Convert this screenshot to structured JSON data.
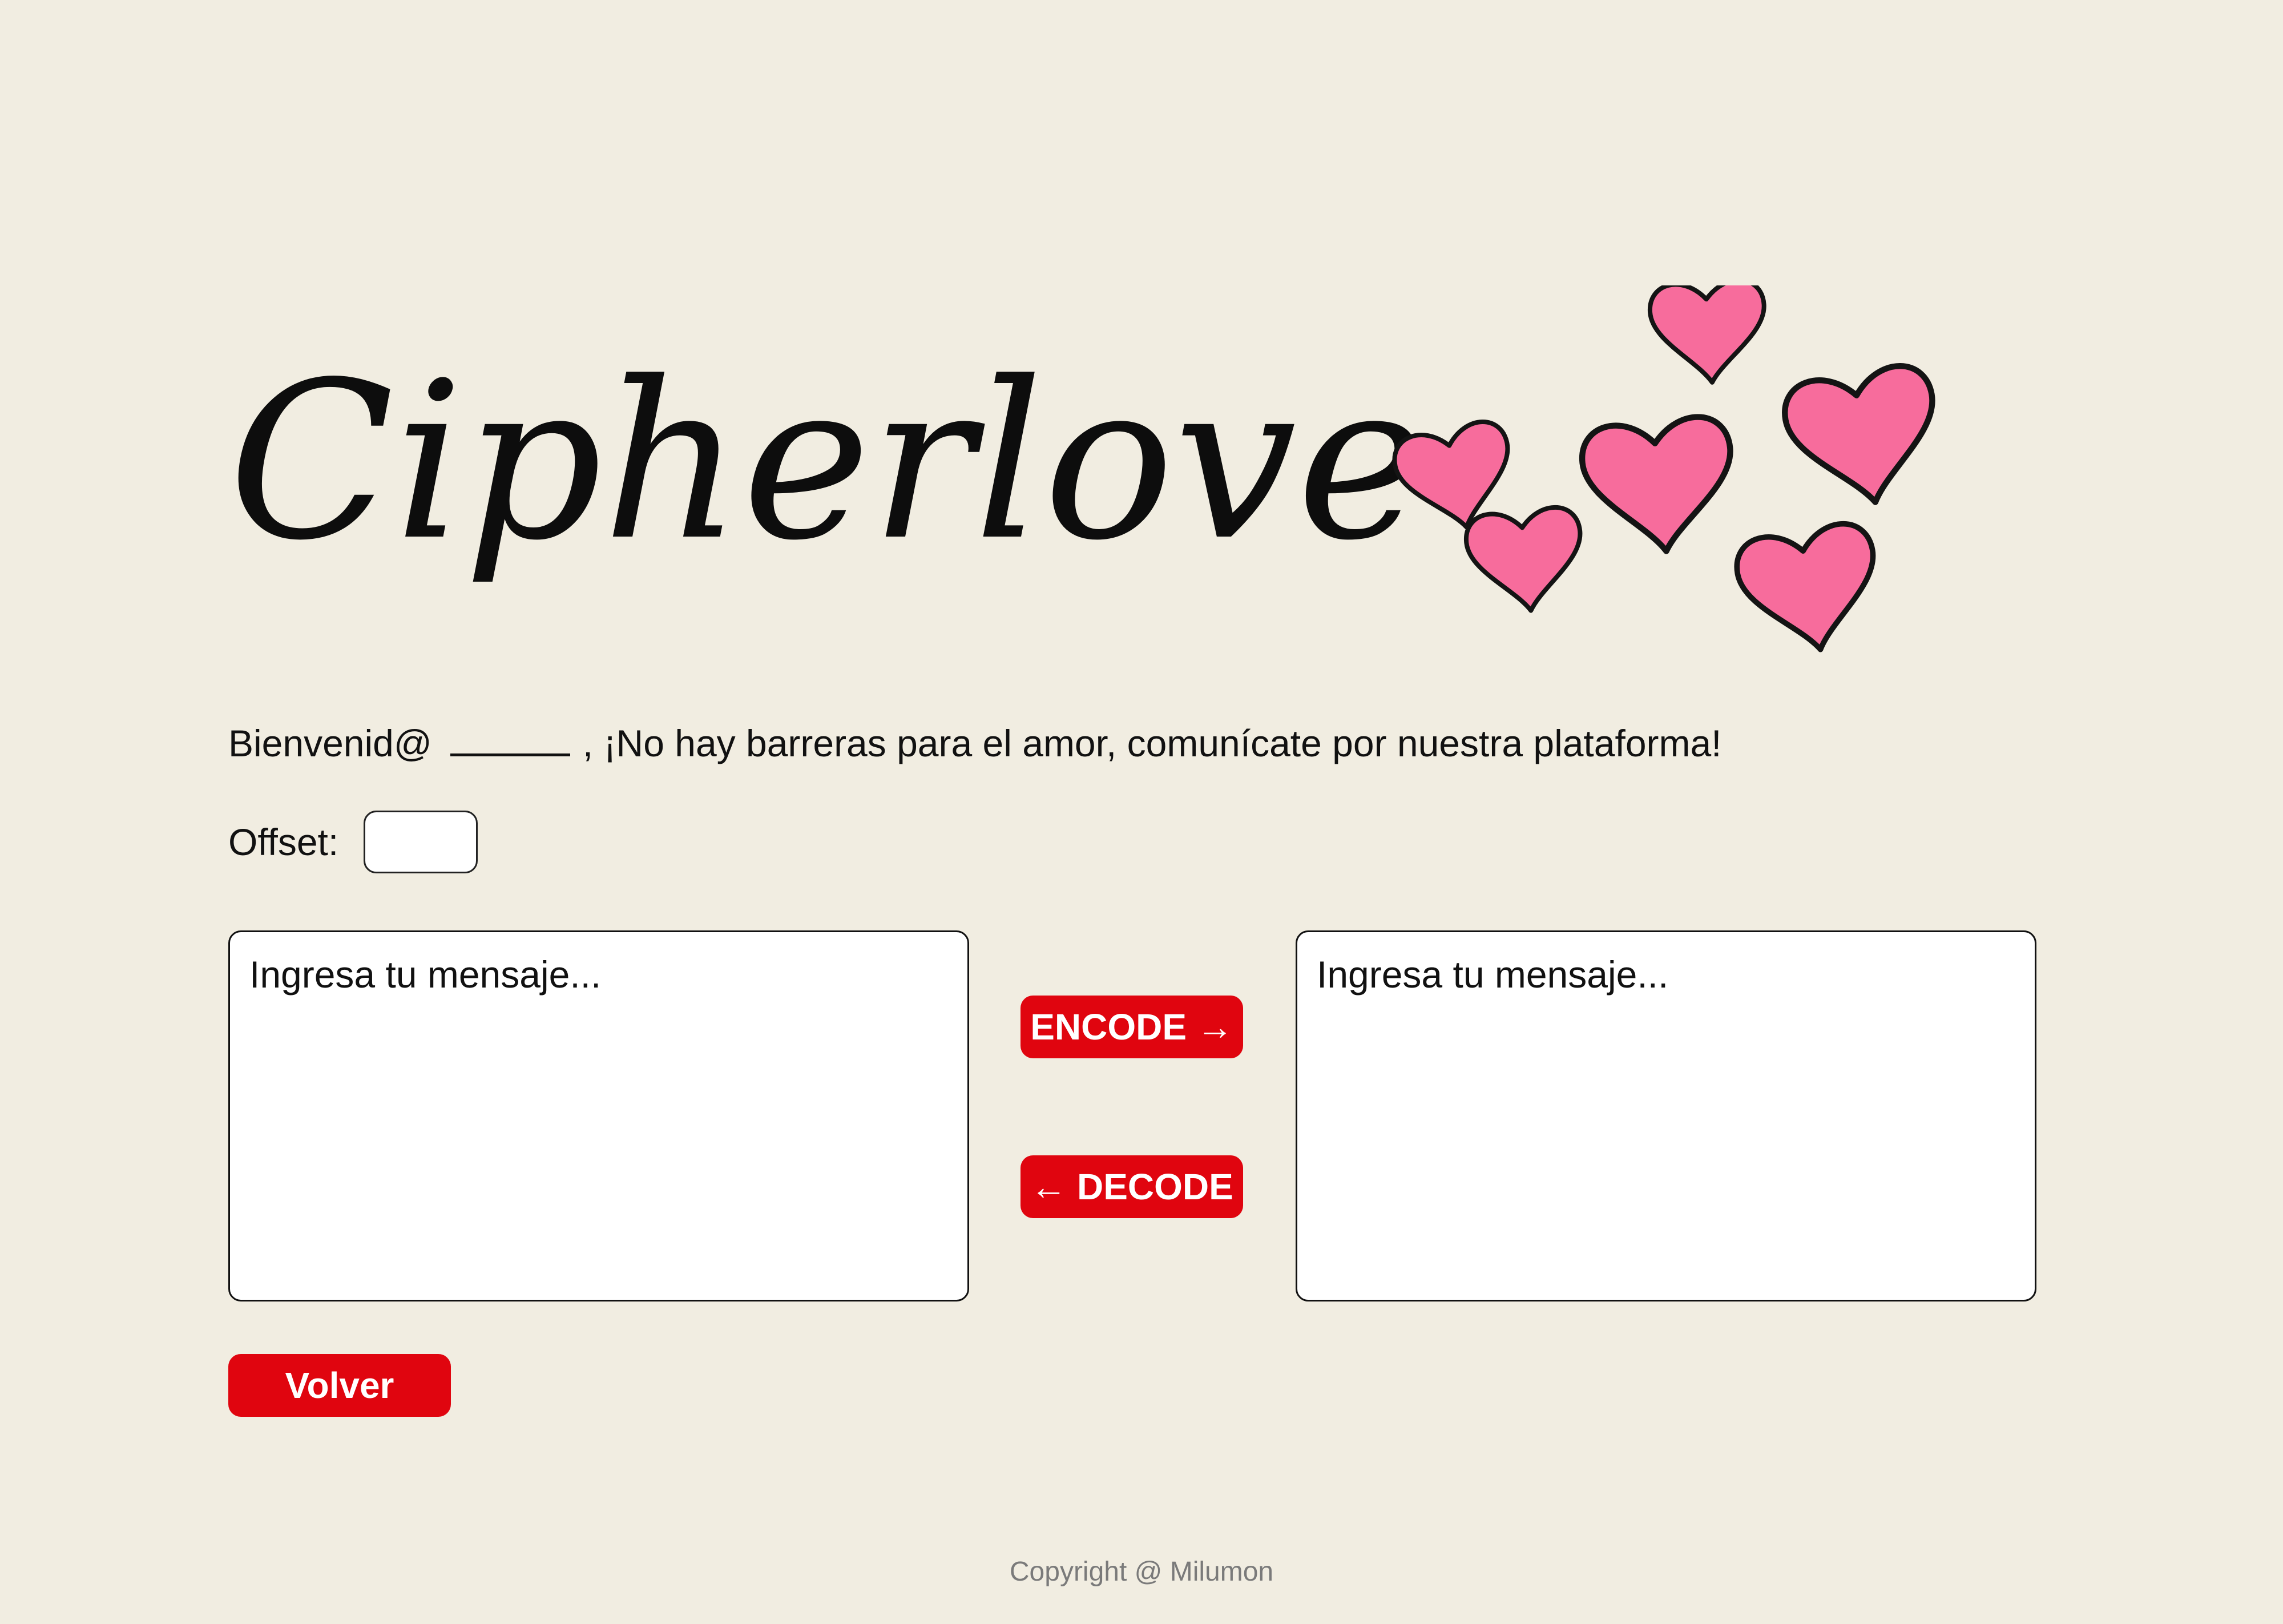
{
  "brand": {
    "logo_text": "Cipherlove"
  },
  "welcome": {
    "greeting": "Bienvenid@",
    "name_value": "",
    "message": ", ¡No hay barreras para el amor, comunícate por nuestra plataforma!"
  },
  "offset": {
    "label": "Offset:",
    "value": ""
  },
  "input_left": {
    "placeholder": "Ingresa tu mensaje...",
    "value": ""
  },
  "input_right": {
    "placeholder": "Ingresa tu mensaje...",
    "value": ""
  },
  "buttons": {
    "encode": "ENCODE →",
    "decode": "← DECODE",
    "back": "Volver"
  },
  "footer": {
    "copyright": "Copyright @ Milumon"
  },
  "colors": {
    "background": "#f1ede1",
    "accent": "#e0050f",
    "heart_fill": "#f76c9c",
    "footer_text": "#7a7a7a"
  },
  "icons": {
    "decoration": "hearts-cluster-icon"
  }
}
